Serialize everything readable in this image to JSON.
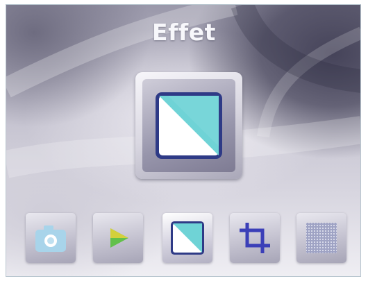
{
  "screen": {
    "title": "Effet"
  },
  "selected": {
    "icon": "effect-icon",
    "accent_color": "#6fd3d6"
  },
  "menu": {
    "items": [
      {
        "icon": "camera-icon",
        "selected": false
      },
      {
        "icon": "play-icon",
        "selected": false
      },
      {
        "icon": "effect-icon",
        "selected": true
      },
      {
        "icon": "crop-icon",
        "selected": false
      },
      {
        "icon": "pattern-icon",
        "selected": false
      }
    ]
  },
  "colors": {
    "cyan": "#6fd3d6",
    "navy": "#2e3a86",
    "crop": "#3b3fb8",
    "green": "#62c04a"
  }
}
